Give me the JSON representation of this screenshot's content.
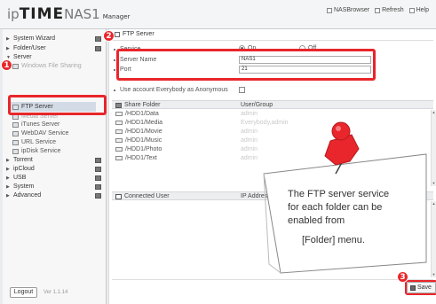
{
  "header": {
    "logo_ip": "ip",
    "logo_time": "TIME",
    "logo_nas": "NAS1",
    "logo_manager": "Manager",
    "links": [
      {
        "label": "NASBrowser",
        "icon": "nas-browser-icon"
      },
      {
        "label": "Refresh",
        "icon": "refresh-icon"
      },
      {
        "label": "Help",
        "icon": "help-icon"
      }
    ]
  },
  "sidebar": {
    "items": [
      {
        "label": "System Wizard"
      },
      {
        "label": "Folder/User"
      },
      {
        "label": "Server"
      },
      {
        "label": "Windows File Sharing"
      },
      {
        "label": "FTP Server"
      },
      {
        "label": "Media Server"
      },
      {
        "label": "iTunes Server"
      },
      {
        "label": "WebDAV Service"
      },
      {
        "label": "URL Service"
      },
      {
        "label": "ipDisk Service"
      },
      {
        "label": "Torrent"
      },
      {
        "label": "ipCloud"
      },
      {
        "label": "USB"
      },
      {
        "label": "System"
      },
      {
        "label": "Advanced"
      }
    ],
    "logout_label": "Logout",
    "version": "Ver 1.1.14"
  },
  "annotations": {
    "badge1": "1",
    "badge2": "2",
    "badge3": "3",
    "callout_lines": [
      "The FTP server service",
      "for each folder can be",
      "enabled from",
      "[Folder] menu."
    ],
    "accent_color": "#e8262b"
  },
  "ftp": {
    "section_title": "FTP Server",
    "service_label": "Service",
    "service_on": "On",
    "service_off": "Off",
    "service_value": "On",
    "server_name_label": "Server Name",
    "server_name_value": "NAS1",
    "port_label": "Port",
    "port_value": "21",
    "anonymous_label": "Use account Everybody as Anonymous",
    "anonymous_checked": false
  },
  "share_table": {
    "col_folder": "Share Folder",
    "col_users": "User/Group",
    "rows": [
      {
        "folder": "/HDD1/Data",
        "users": "admin"
      },
      {
        "folder": "/HDD1/Media",
        "users": "Everybody,admin"
      },
      {
        "folder": "/HDD1/Movie",
        "users": "admin"
      },
      {
        "folder": "/HDD1/Music",
        "users": "admin"
      },
      {
        "folder": "/HDD1/Photo",
        "users": "admin"
      },
      {
        "folder": "/HDD1/Text",
        "users": "admin"
      }
    ]
  },
  "connected_table": {
    "col_user": "Connected User",
    "col_ip": "IP Address"
  },
  "save_label": "Save"
}
